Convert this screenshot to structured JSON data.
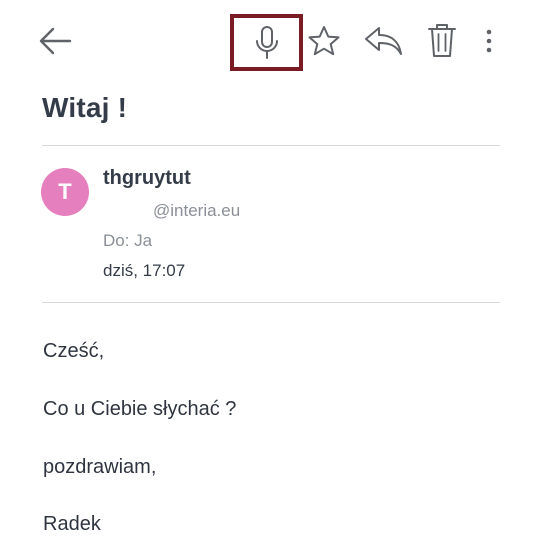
{
  "toolbar": {
    "icons": [
      "arrow-left-icon",
      "microphone-icon",
      "star-icon",
      "reply-icon",
      "trash-icon",
      "more-vertical-icon"
    ],
    "highlight_color": "#7b1c25",
    "icon_color": "#5f6368"
  },
  "message": {
    "subject": "Witaj !",
    "sender_initial": "T",
    "sender_name": "thgruytut",
    "sender_email": "@interia.eu",
    "recipient": "Do: Ja",
    "date": "dziś, 17:07",
    "avatar_color": "#e57fbd",
    "body": {
      "line1": "Cześć,",
      "line2": "Co u Ciebie słychać ?",
      "line3": "pozdrawiam,",
      "line4": "Radek"
    }
  }
}
